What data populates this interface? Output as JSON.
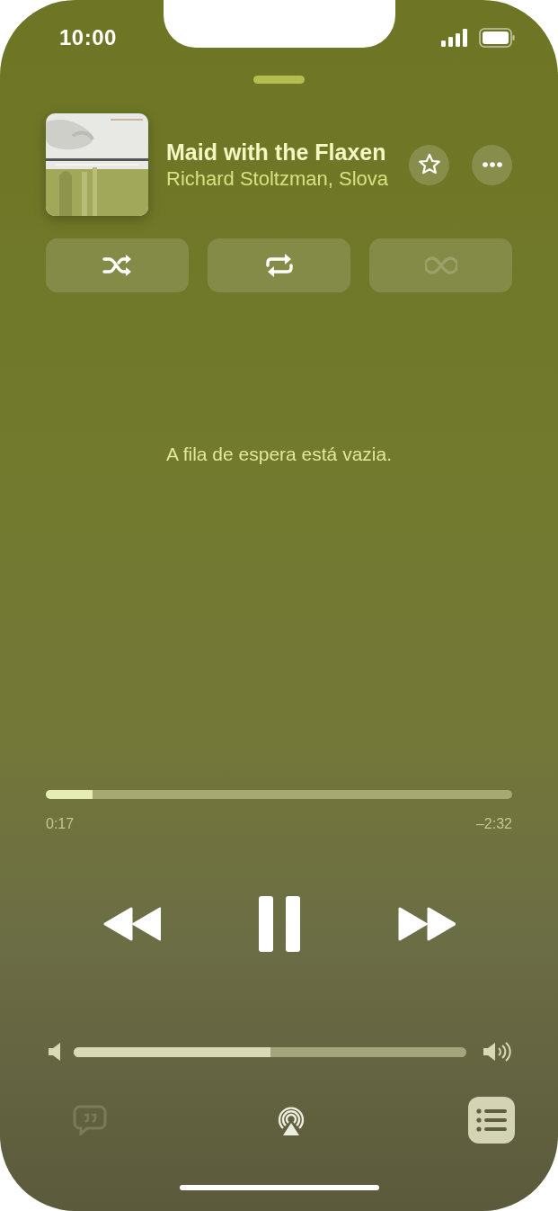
{
  "status_bar": {
    "time": "10:00"
  },
  "now_playing": {
    "title": "Maid with the Flaxen",
    "artist": "Richard Stoltzman, Slova"
  },
  "modes": [
    {
      "kind": "shuffle",
      "disabled": false
    },
    {
      "kind": "repeat",
      "disabled": false
    },
    {
      "kind": "autoplay",
      "disabled": true
    }
  ],
  "queue": {
    "message": "A fila de espera está vazia."
  },
  "progress": {
    "level": 0.1,
    "elapsed": "0:17",
    "remaining": "–2:32"
  },
  "transport": {
    "playing": true
  },
  "volume": {
    "level": 0.5
  },
  "bottom_bar": [
    {
      "kind": "lyrics",
      "selected": false,
      "disabled": true
    },
    {
      "kind": "airplay",
      "selected": false,
      "disabled": false
    },
    {
      "kind": "queue",
      "selected": true,
      "disabled": false
    }
  ]
}
